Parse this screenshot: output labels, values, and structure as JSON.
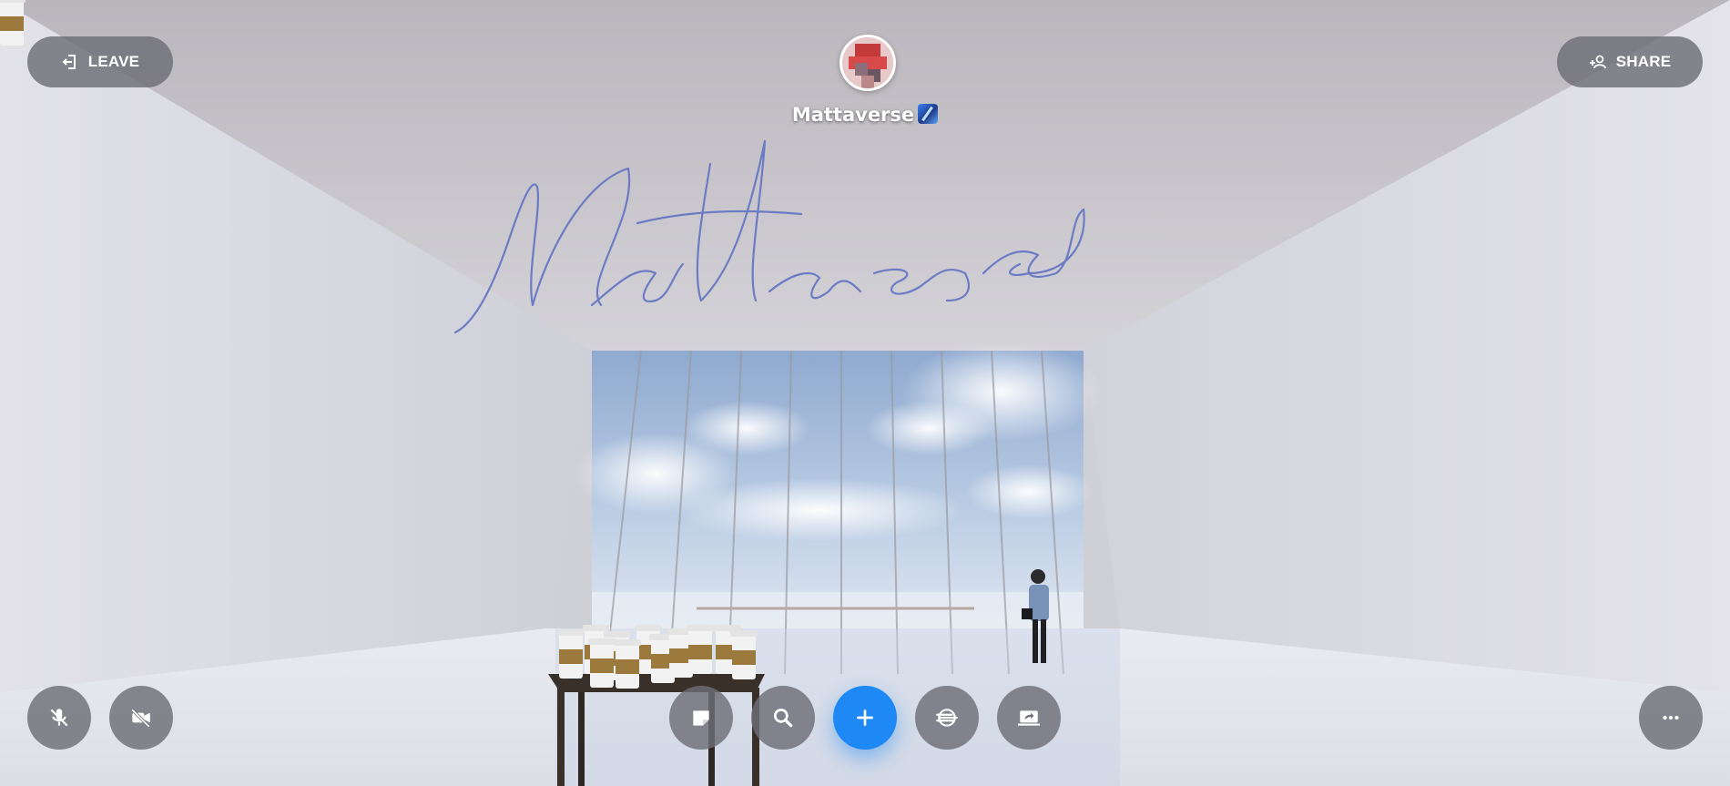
{
  "top_bar": {
    "leave_label": "LEAVE",
    "share_label": "SHARE"
  },
  "host": {
    "name": "Mattaverse",
    "avatar_icon": "pixelated-avatar"
  },
  "room": {
    "wall_signature_text": "Mattaverse",
    "signature_color": "#6b7bc4"
  },
  "bottom_bar": {
    "left_controls": [
      {
        "name": "microphone-muted-button",
        "icon": "mic-off-icon"
      },
      {
        "name": "camera-off-button",
        "icon": "video-off-icon"
      }
    ],
    "center_controls": [
      {
        "name": "sticky-note-button",
        "icon": "note-icon"
      },
      {
        "name": "search-button",
        "icon": "search-icon"
      },
      {
        "name": "add-button",
        "icon": "plus-icon",
        "primary": true
      },
      {
        "name": "environment-button",
        "icon": "wind-globe-icon"
      },
      {
        "name": "share-screen-button",
        "icon": "screen-share-icon"
      }
    ],
    "right_controls": [
      {
        "name": "more-options-button",
        "icon": "more-icon"
      }
    ]
  },
  "colors": {
    "accent": "#1e88f5",
    "control_bg": "#6e6e76"
  }
}
